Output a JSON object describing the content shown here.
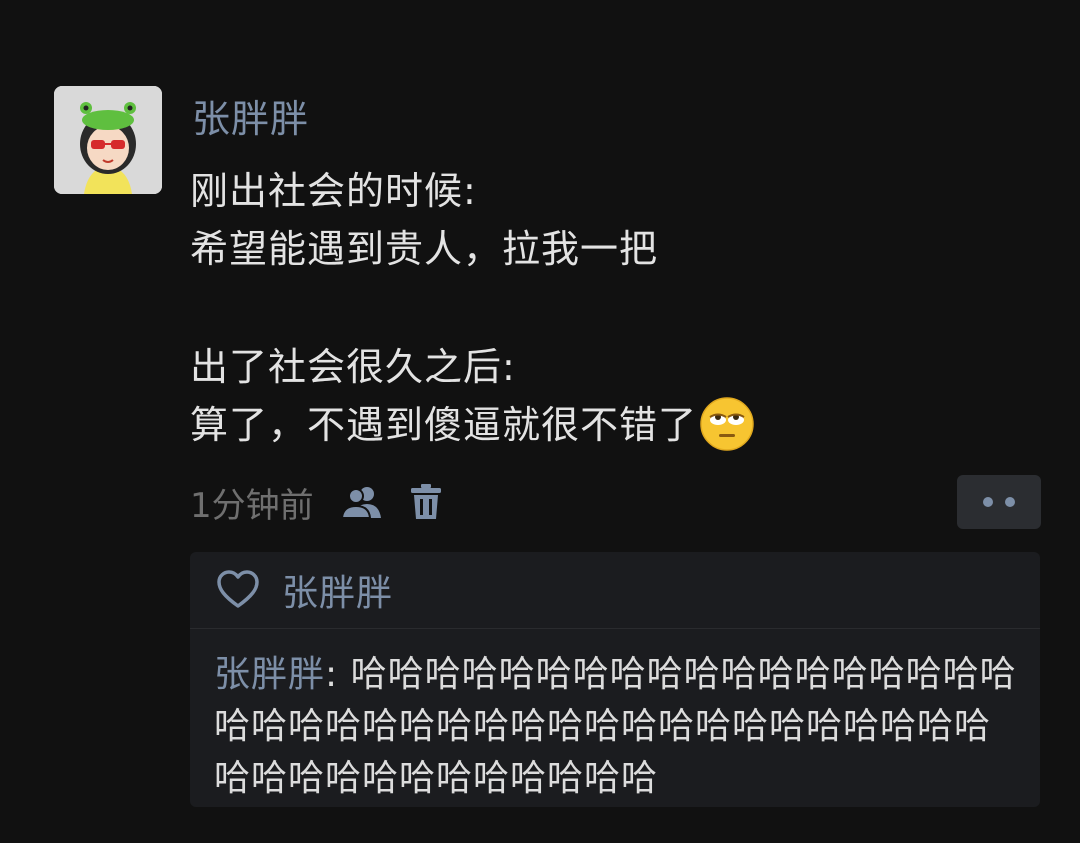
{
  "post": {
    "author": "张胖胖",
    "lines": [
      "刚出社会的时候:",
      "希望能遇到贵人，拉我一把",
      "",
      "出了社会很久之后:",
      "算了，不遇到傻逼就很不错了"
    ],
    "emoji": "rolling-eyes-emoji",
    "timestamp": "1分钟前"
  },
  "icons": {
    "visibility": "people-icon",
    "delete": "trash-icon",
    "more": "more-dots-icon",
    "like": "heart-outline-icon"
  },
  "likes": {
    "names": "张胖胖"
  },
  "comments": [
    {
      "author": "张胖胖",
      "separator": ": ",
      "text": "哈哈哈哈哈哈哈哈哈哈哈哈哈哈哈哈哈哈哈哈哈哈哈哈哈哈哈哈哈哈哈哈哈哈哈哈哈哈哈哈哈哈哈哈哈哈哈哈哈哈哈"
    }
  ],
  "colors": {
    "background": "#111111",
    "name_link": "#7d8fa8",
    "body_text": "#e3e3e3",
    "muted": "#6f6f6f",
    "panel": "#1b1c1f"
  }
}
